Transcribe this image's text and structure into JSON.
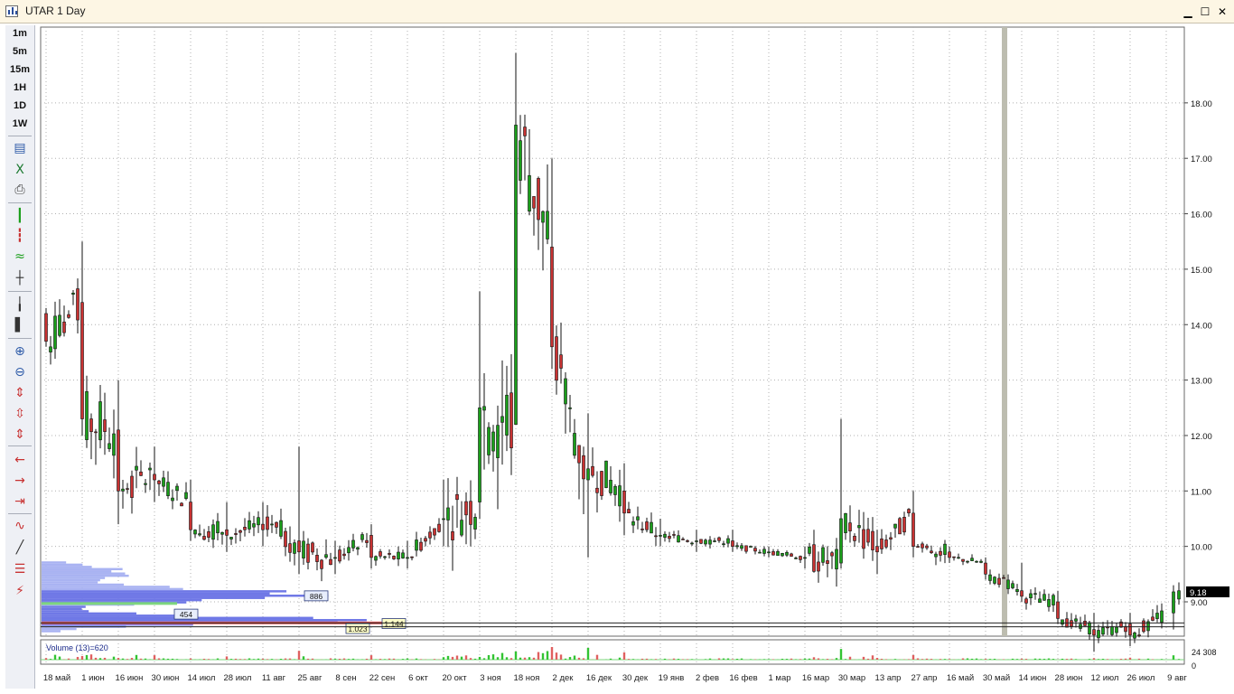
{
  "window": {
    "title": "UTAR 1 Day"
  },
  "toolbar": {
    "timeframes": [
      "1m",
      "5m",
      "15m",
      "1H",
      "1D",
      "1W"
    ],
    "tools": [
      {
        "name": "chart-type-icon",
        "glyph": "▤",
        "color": "#2d5aa8"
      },
      {
        "name": "excel-export-icon",
        "glyph": "X",
        "color": "#1d7a32"
      },
      {
        "name": "print-icon",
        "glyph": "⎙",
        "color": "#444444"
      },
      {
        "name": "candlestick-icon",
        "glyph": "┃",
        "color": "#1a9e1a"
      },
      {
        "name": "bar-chart-icon",
        "glyph": "┇",
        "color": "#c83232"
      },
      {
        "name": "line-chart-icon",
        "glyph": "≈",
        "color": "#1a9e1a"
      },
      {
        "name": "crosshair-icon",
        "glyph": "┼",
        "color": "#333333"
      },
      {
        "name": "line-only-icon",
        "glyph": "╽",
        "color": "#333333"
      },
      {
        "name": "bold-bar-icon",
        "glyph": "▌",
        "color": "#333333"
      },
      {
        "name": "zoom-in-icon",
        "glyph": "⊕",
        "color": "#2d5aa8"
      },
      {
        "name": "zoom-out-icon",
        "glyph": "⊖",
        "color": "#2d5aa8"
      },
      {
        "name": "expand-vertical-icon",
        "glyph": "⇕",
        "color": "#c83232"
      },
      {
        "name": "compress-vertical-icon",
        "glyph": "⇳",
        "color": "#c83232"
      },
      {
        "name": "fit-vertical-icon",
        "glyph": "⇕",
        "color": "#c83232"
      },
      {
        "name": "scroll-left-icon",
        "glyph": "←",
        "color": "#c83232"
      },
      {
        "name": "scroll-right-icon",
        "glyph": "→",
        "color": "#c83232"
      },
      {
        "name": "scroll-end-icon",
        "glyph": "⇥",
        "color": "#c83232"
      },
      {
        "name": "indicator-icon",
        "glyph": "∿",
        "color": "#c83232"
      },
      {
        "name": "draw-line-icon",
        "glyph": "╱",
        "color": "#333333"
      },
      {
        "name": "levels-icon",
        "glyph": "☰",
        "color": "#c83232"
      },
      {
        "name": "delete-drawing-icon",
        "glyph": "⚡",
        "color": "#c83232"
      }
    ]
  },
  "chart_data": {
    "type": "candlestick",
    "title": "UTAR 1 Day",
    "price_axis": {
      "ticks": [
        "9.00",
        "10.00",
        "11.00",
        "12.00",
        "13.00",
        "14.00",
        "15.00",
        "16.00",
        "17.00",
        "18.00"
      ],
      "ylim": [
        8.2,
        19.0
      ]
    },
    "last_price": "9.18",
    "date_axis": [
      "18 май",
      "1 июн",
      "16 июн",
      "30 июн",
      "14 июл",
      "28 июл",
      "11 авг",
      "25 авг",
      "8 сен",
      "22 сен",
      "6 окт",
      "20 окт",
      "3 ноя",
      "18 ноя",
      "2 дек",
      "16 дек",
      "30 дек",
      "19 янв",
      "2 фев",
      "16 фев",
      "1 мар",
      "16 мар",
      "30 мар",
      "13 апр",
      "27 апр",
      "16 май",
      "30 май",
      "14 июн",
      "28 июн",
      "12 июл",
      "26 июл",
      "9 авг"
    ],
    "horizontal_levels": [
      8.55,
      8.62
    ],
    "volume_profile_labels": [
      "886",
      "454",
      "1.023",
      "1.144"
    ],
    "volume": {
      "label": "Volume (13)=620",
      "axis_ticks": [
        "24 308",
        "0"
      ]
    },
    "key_points": [
      {
        "date": "18 май",
        "open": 14.2,
        "high": 14.3,
        "low": 13.6,
        "close": 13.7
      },
      {
        "date": "1 июн",
        "open": 14.4,
        "high": 15.5,
        "low": 12.0,
        "close": 12.3
      },
      {
        "date": "16 июн",
        "open": 12.1,
        "high": 13.0,
        "low": 10.4,
        "close": 11.0
      },
      {
        "date": "30 июн",
        "open": 11.3,
        "high": 11.8,
        "low": 10.8,
        "close": 11.2
      },
      {
        "date": "14 июл",
        "open": 10.8,
        "high": 11.2,
        "low": 10.1,
        "close": 10.3
      },
      {
        "date": "28 июл",
        "open": 10.3,
        "high": 10.8,
        "low": 9.9,
        "close": 10.2
      },
      {
        "date": "11 авг",
        "open": 10.4,
        "high": 10.8,
        "low": 10.0,
        "close": 10.3
      },
      {
        "date": "25 авг",
        "open": 10.1,
        "high": 11.8,
        "low": 9.5,
        "close": 9.9
      },
      {
        "date": "8 сен",
        "open": 9.8,
        "high": 10.1,
        "low": 9.5,
        "close": 9.8
      },
      {
        "date": "22 сен",
        "open": 10.2,
        "high": 10.4,
        "low": 9.6,
        "close": 9.8
      },
      {
        "date": "6 окт",
        "open": 9.8,
        "high": 10.1,
        "low": 9.6,
        "close": 9.8
      },
      {
        "date": "20 окт",
        "open": 10.5,
        "high": 11.2,
        "low": 10.0,
        "close": 10.5
      },
      {
        "date": "3 ноя",
        "open": 10.8,
        "high": 14.6,
        "low": 10.5,
        "close": 12.5
      },
      {
        "date": "18 ноя",
        "open": 12.2,
        "high": 18.9,
        "low": 12.2,
        "close": 17.6
      },
      {
        "date": "2 дек",
        "open": 15.4,
        "high": 17.0,
        "low": 13.2,
        "close": 13.6
      },
      {
        "date": "16 дек",
        "open": 11.2,
        "high": 12.4,
        "low": 9.8,
        "close": 11.4
      },
      {
        "date": "30 дек",
        "open": 11.0,
        "high": 11.5,
        "low": 10.2,
        "close": 10.6
      },
      {
        "date": "19 янв",
        "open": 10.2,
        "high": 10.5,
        "low": 10.0,
        "close": 10.2
      },
      {
        "date": "2 фев",
        "open": 10.1,
        "high": 10.3,
        "low": 9.9,
        "close": 10.1
      },
      {
        "date": "16 фев",
        "open": 10.1,
        "high": 10.3,
        "low": 9.9,
        "close": 10.0
      },
      {
        "date": "1 мар",
        "open": 9.9,
        "high": 10.0,
        "low": 9.8,
        "close": 9.9
      },
      {
        "date": "16 мар",
        "open": 9.8,
        "high": 10.0,
        "low": 9.6,
        "close": 9.8
      },
      {
        "date": "30 мар",
        "open": 9.7,
        "high": 12.3,
        "low": 9.6,
        "close": 10.5
      },
      {
        "date": "13 апр",
        "open": 10.0,
        "high": 10.3,
        "low": 9.5,
        "close": 9.9
      },
      {
        "date": "27 апр",
        "open": 10.6,
        "high": 11.0,
        "low": 9.8,
        "close": 10.0
      },
      {
        "date": "16 май",
        "open": 9.9,
        "high": 10.0,
        "low": 9.7,
        "close": 9.8
      },
      {
        "date": "30 май",
        "open": 9.7,
        "high": 9.8,
        "low": 9.4,
        "close": 9.5
      },
      {
        "date": "14 июн",
        "open": 9.2,
        "high": 9.7,
        "low": 9.0,
        "close": 9.1
      },
      {
        "date": "28 июн",
        "open": 9.0,
        "high": 9.2,
        "low": 8.6,
        "close": 8.7
      },
      {
        "date": "12 июл",
        "open": 8.5,
        "high": 8.8,
        "low": 8.1,
        "close": 8.4
      },
      {
        "date": "26 июл",
        "open": 8.6,
        "high": 8.8,
        "low": 8.2,
        "close": 8.4
      },
      {
        "date": "9 авг",
        "open": 8.8,
        "high": 9.3,
        "low": 8.5,
        "close": 9.18
      }
    ],
    "colors": {
      "up": "#1a9e1a",
      "down": "#c83232",
      "grid": "#b0b0b0",
      "highlight_bar": "#bdbdb0"
    }
  }
}
